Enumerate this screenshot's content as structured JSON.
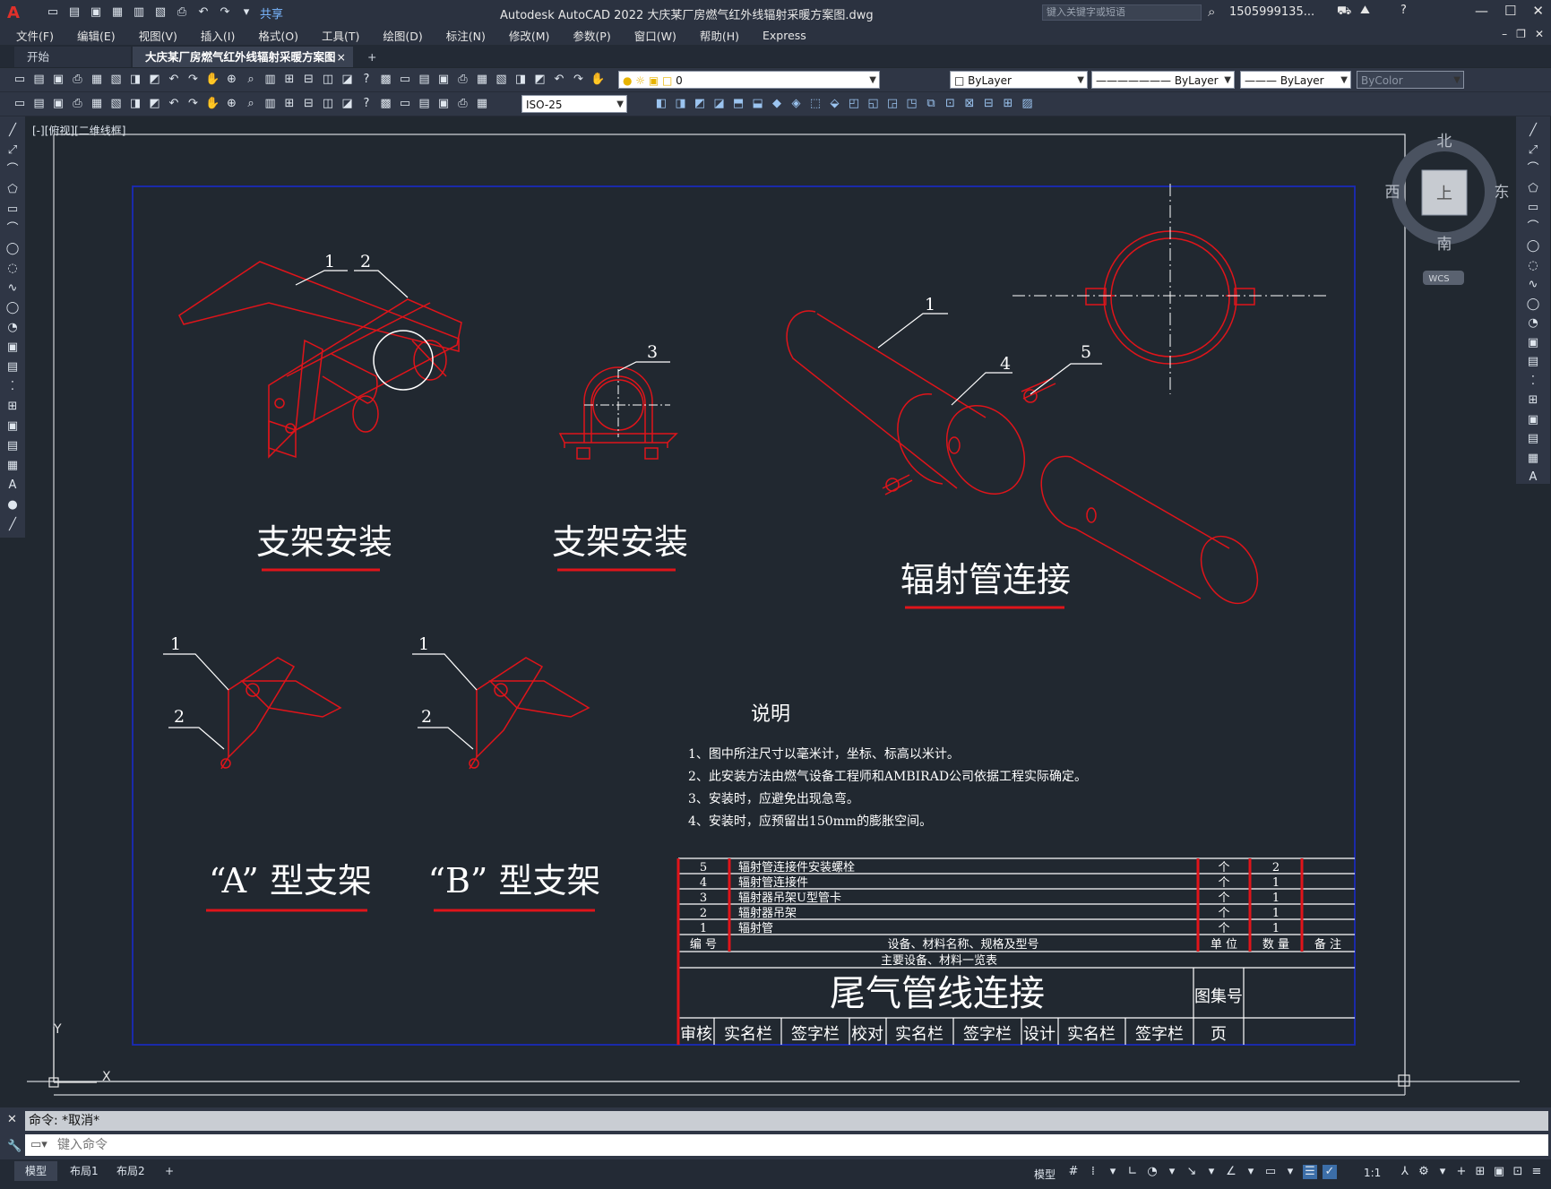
{
  "app": {
    "logo": "A",
    "title": "Autodesk AutoCAD 2022    大庆某厂房燃气红外线辐射采暖方案图.dwg",
    "share": "共享",
    "search_placeholder": "键入关键字或短语",
    "user": "1505999135...",
    "help": "?"
  },
  "menu": [
    "文件(F)",
    "编辑(E)",
    "视图(V)",
    "插入(I)",
    "格式(O)",
    "工具(T)",
    "绘图(D)",
    "标注(N)",
    "修改(M)",
    "参数(P)",
    "窗口(W)",
    "帮助(H)",
    "Express"
  ],
  "tabs": {
    "start": "开始",
    "drawing": "大庆某厂房燃气红外线辐射采暖方案图*",
    "add": "+",
    "close": "×"
  },
  "toolbar": {
    "layer": "0",
    "color": "ByLayer",
    "linetype": "ByLayer",
    "lineweight": "ByLayer",
    "plotstyle": "ByColor",
    "dimstyle": "ISO-25"
  },
  "viewport_label": "[-][俯视][二维线框]",
  "viewcube": {
    "north": "北",
    "south": "南",
    "east": "东",
    "west": "西",
    "top": "上",
    "wcs": "WCS"
  },
  "drawing": {
    "callouts": {
      "c1": "1",
      "c2": "2",
      "c3": "3",
      "c4": "4",
      "c5": "5"
    },
    "labels": {
      "bracket_install_1": "支架安装",
      "bracket_install_2": "支架安装",
      "radiant_tube_connection": "辐射管连接",
      "type_a": "“A” 型支架",
      "type_b": "“B” 型支架"
    },
    "notes": {
      "heading": "说明",
      "items": [
        "1、图中所注尺寸以毫米计，坐标、标高以米计。",
        "2、此安装方法由燃气设备工程师和AMBIRAD公司依据工程实际确定。",
        "3、安装时，应避免出现急弯。",
        "4、安装时，应预留出150mm的膨胀空间。"
      ]
    },
    "table": {
      "rows": [
        {
          "no": "5",
          "name": "辐射管连接件安装螺栓",
          "unit": "个",
          "qty": "2"
        },
        {
          "no": "4",
          "name": "辐射管连接件",
          "unit": "个",
          "qty": "1"
        },
        {
          "no": "3",
          "name": "辐射器吊架U型管卡",
          "unit": "个",
          "qty": "1"
        },
        {
          "no": "2",
          "name": "辐射器吊架",
          "unit": "个",
          "qty": "1"
        },
        {
          "no": "1",
          "name": "辐射管",
          "unit": "个",
          "qty": "1"
        }
      ],
      "header": {
        "no": "编 号",
        "name": "设备、材料名称、规格及型号",
        "unit": "单 位",
        "qty": "数 量",
        "remark": "备 注"
      },
      "caption": "主要设备、材料一览表"
    },
    "titleblock": {
      "title": "尾气管线连接",
      "atlas_no": "图集号",
      "page": "页",
      "review": "审核",
      "check": "校对",
      "design": "设计",
      "real_name": "实名栏",
      "signature": "签字栏"
    },
    "axis": {
      "y": "Y",
      "x": "X"
    }
  },
  "command": {
    "history": "命令: *取消*",
    "placeholder": "键入命令"
  },
  "layouts": [
    "模型",
    "布局1",
    "布局2"
  ],
  "status": {
    "model": "模型",
    "scale": "1:1"
  },
  "colors": {
    "line": "#e0141a",
    "frame": "#1a2ab8",
    "text": "#ffffff",
    "bg": "#212830"
  }
}
